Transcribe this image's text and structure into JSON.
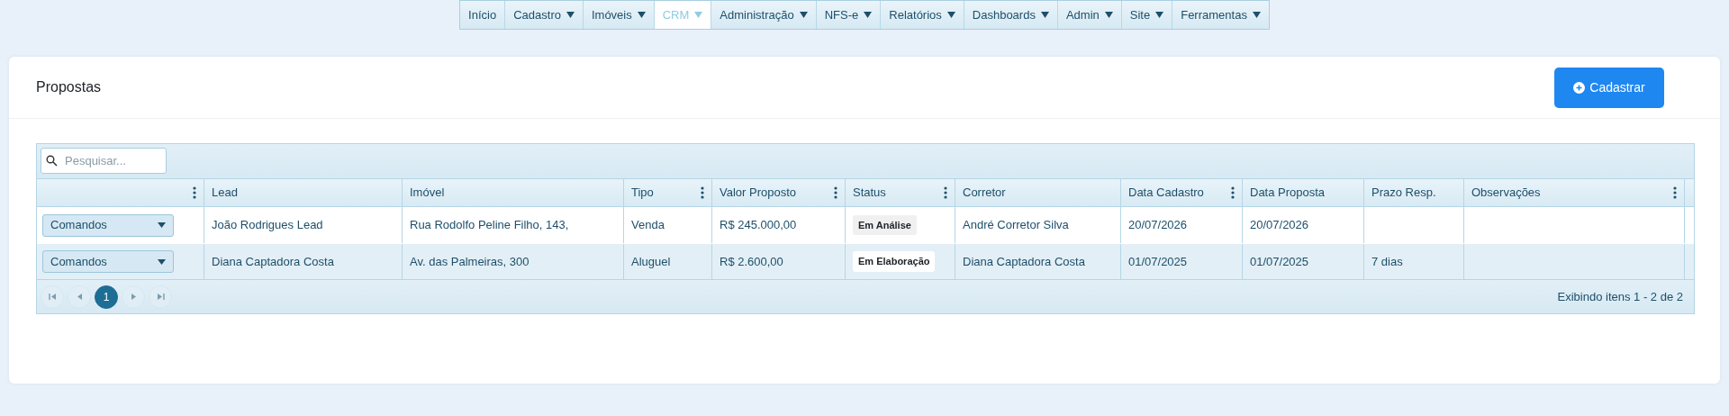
{
  "menu": [
    {
      "label": "Início",
      "selected": false,
      "dropdown": false
    },
    {
      "label": "Cadastro",
      "selected": false,
      "dropdown": true
    },
    {
      "label": "Imóveis",
      "selected": false,
      "dropdown": true
    },
    {
      "label": "CRM",
      "selected": true,
      "dropdown": true
    },
    {
      "label": "Administração",
      "selected": false,
      "dropdown": true
    },
    {
      "label": "NFS-e",
      "selected": false,
      "dropdown": true
    },
    {
      "label": "Relatórios",
      "selected": false,
      "dropdown": true
    },
    {
      "label": "Dashboards",
      "selected": false,
      "dropdown": true
    },
    {
      "label": "Admin",
      "selected": false,
      "dropdown": true
    },
    {
      "label": "Site",
      "selected": false,
      "dropdown": true
    },
    {
      "label": "Ferramentas",
      "selected": false,
      "dropdown": true
    }
  ],
  "page": {
    "title": "Propostas",
    "add_button": "Cadastrar"
  },
  "grid": {
    "search": {
      "placeholder": "Pesquisar..."
    },
    "columns": [
      {
        "menu": true
      },
      {
        "label": "Lead",
        "menu": false
      },
      {
        "label": "Imóvel",
        "menu": false
      },
      {
        "label": "Tipo",
        "menu": true
      },
      {
        "label": "Valor Proposto",
        "menu": true
      },
      {
        "label": "Status",
        "menu": true
      },
      {
        "label": "Corretor",
        "menu": false
      },
      {
        "label": "Data Cadastro",
        "menu": true
      },
      {
        "label": "Data Proposta",
        "menu": false
      },
      {
        "label": "Prazo Resp.",
        "menu": false
      },
      {
        "label": "Observações",
        "menu": true
      }
    ],
    "rows": [
      {
        "cells": [
          {
            "command": "Comandos"
          },
          "João Rodrigues Lead",
          "Rua Rodolfo Peline Filho, 143,",
          "Venda",
          "R$ 245.000,00",
          {
            "badge": "Em Análise"
          },
          "André Corretor Silva",
          "20/07/2026",
          "20/07/2026",
          null,
          null
        ]
      },
      {
        "cells": [
          {
            "command": "Comandos"
          },
          "Diana Captadora Costa",
          "Av. das Palmeiras, 300",
          "Aluguel",
          "R$ 2.600,00",
          {
            "badge": "Em Elaboração"
          },
          "Diana Captadora Costa",
          "01/07/2025",
          "01/07/2025",
          "7 dias",
          null
        ]
      }
    ],
    "pager": {
      "buttons": [
        {
          "kind": "first",
          "disabled": true
        },
        {
          "kind": "prev",
          "disabled": true
        },
        {
          "kind": "page",
          "label": "1",
          "selected": true
        },
        {
          "kind": "next",
          "disabled": true
        },
        {
          "kind": "last",
          "disabled": true
        }
      ],
      "summary": "Exibindo itens 1 - 2 de 2"
    }
  }
}
